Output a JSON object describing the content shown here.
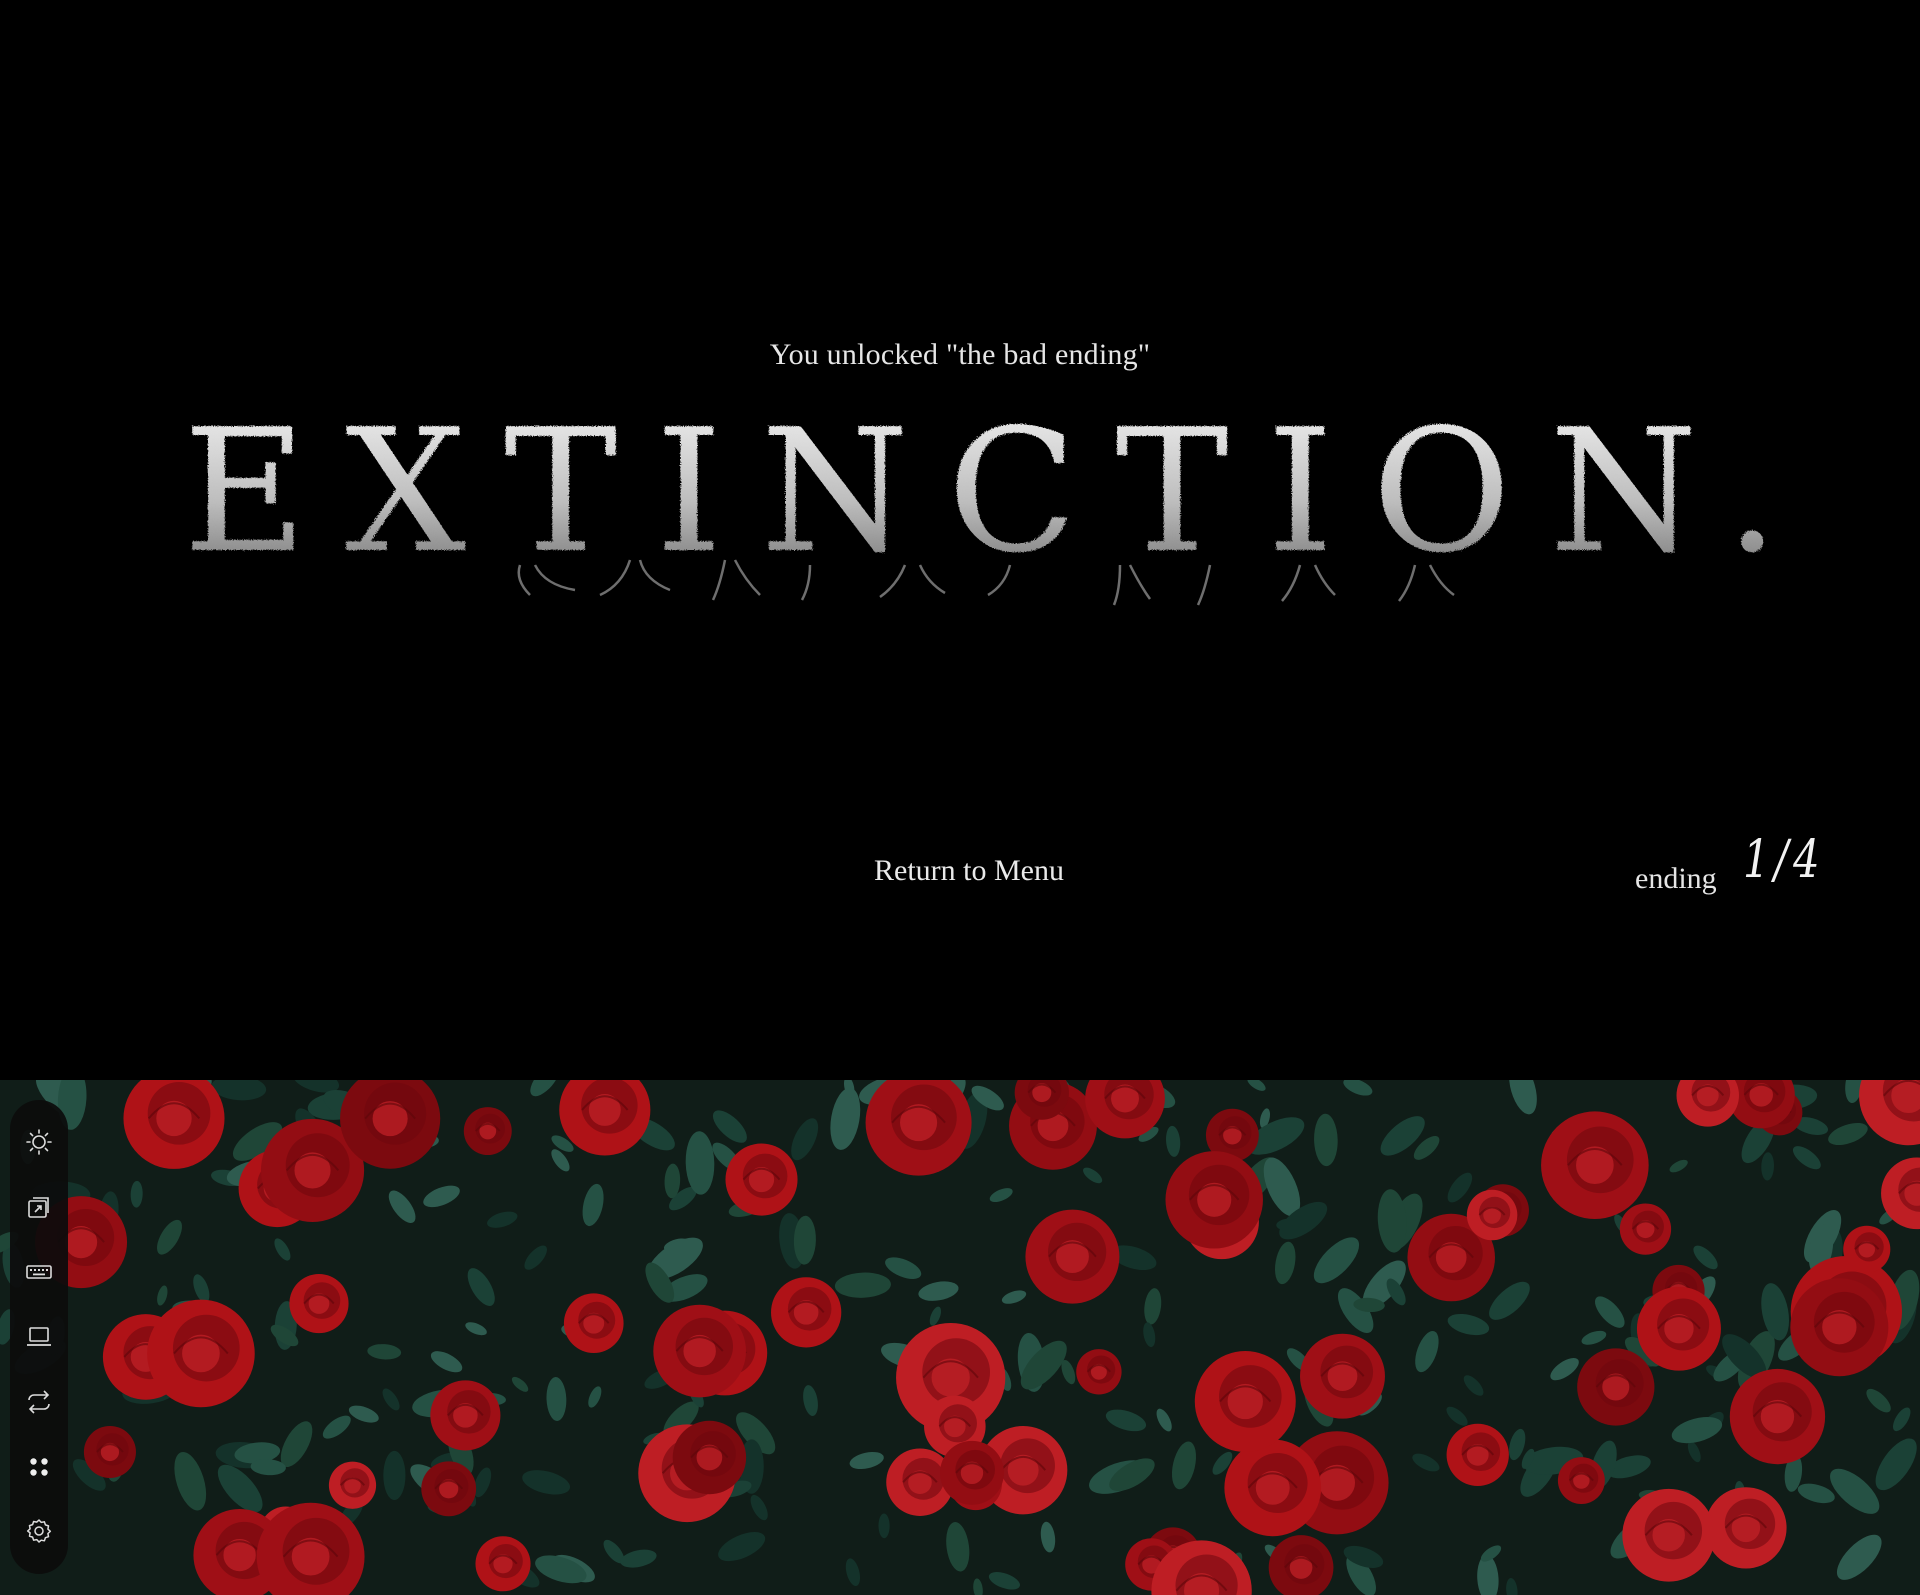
{
  "game": {
    "unlock_message": "You unlocked \"the bad ending\"",
    "ending_title": "EXTINCTION.",
    "return_button_label": "Return to Menu",
    "ending_label": "ending",
    "ending_count": "1/4"
  },
  "dock": {
    "items": [
      {
        "icon": "brightness-icon"
      },
      {
        "icon": "window-switch-icon"
      },
      {
        "icon": "keyboard-icon"
      },
      {
        "icon": "laptop-icon"
      },
      {
        "icon": "swap-icon"
      },
      {
        "icon": "apps-grid-icon"
      },
      {
        "icon": "settings-gear-icon"
      }
    ]
  },
  "colors": {
    "background": "#000000",
    "text": "#e6e6e6",
    "rose_red": "#c8151b",
    "leaf_green": "#1f4a3e"
  }
}
